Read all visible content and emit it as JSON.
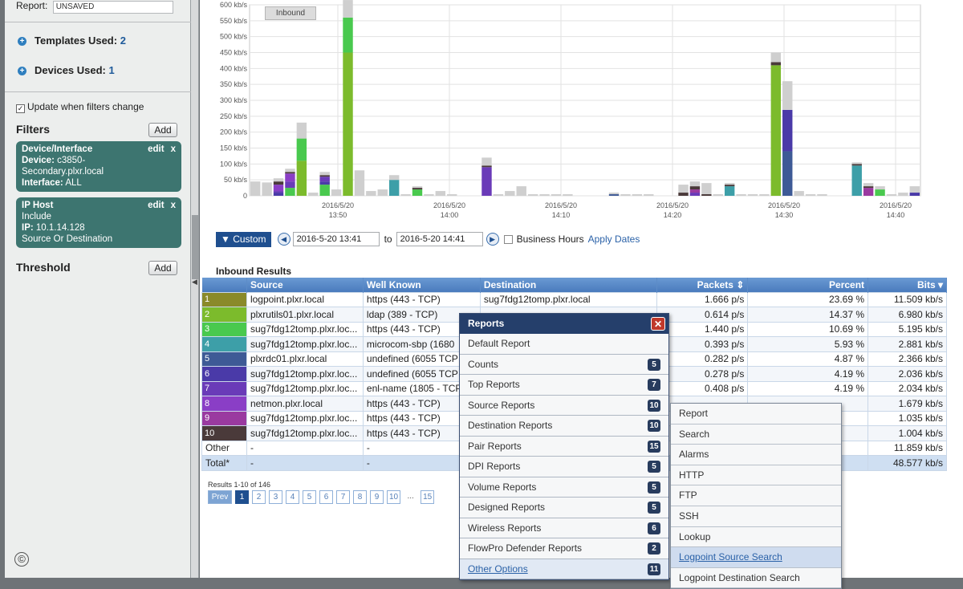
{
  "sidebar": {
    "report_label": "Report:",
    "report_value": "UNSAVED",
    "templates_label": "Templates Used:",
    "templates_count": "2",
    "devices_label": "Devices Used:",
    "devices_count": "1",
    "update_label": "Update when filters change",
    "filters_title": "Filters",
    "add_label": "Add",
    "filter_cards": [
      {
        "title": "Device/Interface",
        "edit": "edit",
        "close": "x",
        "l1_key": "Device:",
        "l1_val": "c3850-",
        "l2": "Secondary.plxr.local",
        "l3_key": "Interface:",
        "l3_val": "ALL"
      },
      {
        "title": "IP Host",
        "edit": "edit",
        "close": "x",
        "l1": "Include",
        "l2_key": "IP:",
        "l2_val": "10.1.14.128",
        "l3": "Source Or Destination"
      }
    ],
    "threshold_title": "Threshold",
    "threshold_add": "Add",
    "copyright": "©"
  },
  "chart": {
    "legend_label": "Inbound"
  },
  "chart_data": {
    "type": "bar",
    "stacked": true,
    "ylabel": "",
    "y_unit": "kb/s",
    "ylim": [
      0,
      600
    ],
    "y_ticks": [
      "0",
      "50 kb/s",
      "100 kb/s",
      "150 kb/s",
      "200 kb/s",
      "250 kb/s",
      "300 kb/s",
      "350 kb/s",
      "400 kb/s",
      "450 kb/s",
      "500 kb/s",
      "550 kb/s",
      "600 kb/s"
    ],
    "x_ticks": [
      {
        "d": "2016/5/20",
        "t": "13:50"
      },
      {
        "d": "2016/5/20",
        "t": "14:00"
      },
      {
        "d": "2016/5/20",
        "t": "14:10"
      },
      {
        "d": "2016/5/20",
        "t": "14:20"
      },
      {
        "d": "2016/5/20",
        "t": "14:30"
      },
      {
        "d": "2016/5/20",
        "t": "14:40"
      }
    ],
    "colors": [
      "#8a8a2a",
      "#7cbb2c",
      "#49c94e",
      "#3d9fa8",
      "#3e5a96",
      "#4a3aa8",
      "#6a3bb8",
      "#8a3ec6",
      "#9a3aa0",
      "#4a3a3a",
      "#cfcfcf"
    ],
    "bars": [
      [
        0,
        0,
        0,
        0,
        0,
        0,
        0,
        0,
        0,
        0,
        45
      ],
      [
        0,
        0,
        0,
        0,
        0,
        0,
        0,
        0,
        0,
        0,
        42
      ],
      [
        0,
        0,
        0,
        0,
        0,
        10,
        5,
        20,
        0,
        10,
        10
      ],
      [
        0,
        0,
        25,
        0,
        0,
        0,
        20,
        25,
        0,
        5,
        10
      ],
      [
        0,
        110,
        70,
        0,
        0,
        0,
        0,
        0,
        0,
        0,
        50
      ],
      [
        0,
        0,
        0,
        0,
        0,
        0,
        0,
        0,
        0,
        0,
        10
      ],
      [
        0,
        0,
        35,
        0,
        0,
        10,
        15,
        0,
        0,
        5,
        10
      ],
      [
        0,
        0,
        0,
        0,
        0,
        0,
        0,
        0,
        0,
        0,
        20
      ],
      [
        0,
        450,
        110,
        0,
        0,
        0,
        0,
        0,
        0,
        0,
        55
      ],
      [
        0,
        0,
        0,
        0,
        0,
        0,
        0,
        0,
        0,
        0,
        80
      ],
      [
        0,
        0,
        0,
        0,
        0,
        0,
        0,
        0,
        0,
        0,
        15
      ],
      [
        0,
        0,
        0,
        0,
        0,
        0,
        0,
        0,
        0,
        0,
        20
      ],
      [
        0,
        0,
        0,
        50,
        0,
        0,
        0,
        0,
        0,
        0,
        15
      ],
      [
        0,
        0,
        0,
        0,
        0,
        0,
        0,
        0,
        0,
        0,
        5
      ],
      [
        0,
        0,
        20,
        0,
        0,
        0,
        0,
        0,
        0,
        5,
        5
      ],
      [
        0,
        0,
        0,
        0,
        0,
        0,
        0,
        0,
        0,
        0,
        5
      ],
      [
        0,
        0,
        0,
        0,
        0,
        0,
        0,
        0,
        0,
        0,
        15
      ],
      [
        0,
        0,
        0,
        0,
        0,
        0,
        0,
        0,
        0,
        0,
        5
      ],
      [
        0,
        0,
        0,
        0,
        0,
        0,
        0,
        0,
        0,
        0,
        0
      ],
      [
        0,
        0,
        0,
        0,
        0,
        0,
        0,
        0,
        0,
        0,
        0
      ],
      [
        0,
        0,
        0,
        0,
        0,
        0,
        90,
        0,
        0,
        5,
        25
      ],
      [
        0,
        0,
        0,
        0,
        0,
        0,
        0,
        0,
        0,
        0,
        5
      ],
      [
        0,
        0,
        0,
        0,
        0,
        0,
        0,
        0,
        0,
        0,
        15
      ],
      [
        0,
        0,
        0,
        0,
        0,
        0,
        0,
        0,
        0,
        0,
        30
      ],
      [
        0,
        0,
        0,
        0,
        0,
        0,
        0,
        0,
        0,
        0,
        5
      ],
      [
        0,
        0,
        0,
        0,
        0,
        0,
        0,
        0,
        0,
        0,
        5
      ],
      [
        0,
        0,
        0,
        0,
        0,
        0,
        0,
        0,
        0,
        0,
        5
      ],
      [
        0,
        0,
        0,
        0,
        0,
        0,
        0,
        0,
        0,
        0,
        5
      ],
      [
        0,
        0,
        0,
        0,
        0,
        0,
        0,
        0,
        0,
        0,
        0
      ],
      [
        0,
        0,
        0,
        0,
        0,
        0,
        0,
        0,
        0,
        0,
        0
      ],
      [
        0,
        0,
        0,
        0,
        0,
        0,
        0,
        0,
        0,
        0,
        0
      ],
      [
        0,
        0,
        0,
        0,
        5,
        0,
        0,
        0,
        0,
        0,
        5
      ],
      [
        0,
        0,
        0,
        0,
        0,
        0,
        0,
        0,
        0,
        0,
        5
      ],
      [
        0,
        0,
        0,
        0,
        0,
        0,
        0,
        0,
        0,
        0,
        5
      ],
      [
        0,
        0,
        0,
        0,
        0,
        0,
        0,
        0,
        0,
        0,
        5
      ],
      [
        0,
        0,
        0,
        0,
        0,
        0,
        0,
        0,
        0,
        0,
        0
      ],
      [
        0,
        0,
        0,
        0,
        0,
        0,
        0,
        0,
        0,
        0,
        0
      ],
      [
        0,
        0,
        0,
        0,
        0,
        0,
        0,
        0,
        0,
        10,
        25
      ],
      [
        0,
        0,
        0,
        0,
        0,
        0,
        10,
        0,
        10,
        10,
        15
      ],
      [
        0,
        0,
        0,
        0,
        0,
        0,
        0,
        0,
        0,
        5,
        35
      ],
      [
        0,
        0,
        0,
        0,
        0,
        0,
        0,
        0,
        0,
        0,
        5
      ],
      [
        0,
        0,
        0,
        30,
        0,
        0,
        0,
        0,
        0,
        5,
        5
      ],
      [
        0,
        0,
        0,
        0,
        0,
        0,
        0,
        0,
        0,
        0,
        5
      ],
      [
        0,
        0,
        0,
        0,
        0,
        0,
        0,
        0,
        0,
        0,
        5
      ],
      [
        0,
        0,
        0,
        0,
        0,
        0,
        0,
        0,
        0,
        0,
        5
      ],
      [
        0,
        410,
        0,
        0,
        0,
        0,
        0,
        0,
        0,
        10,
        30
      ],
      [
        0,
        0,
        0,
        0,
        140,
        130,
        0,
        0,
        0,
        0,
        90
      ],
      [
        0,
        0,
        0,
        0,
        0,
        0,
        0,
        0,
        0,
        0,
        15
      ],
      [
        0,
        0,
        0,
        0,
        0,
        0,
        0,
        0,
        0,
        0,
        5
      ],
      [
        0,
        0,
        0,
        0,
        0,
        0,
        0,
        0,
        0,
        0,
        5
      ],
      [
        0,
        0,
        0,
        0,
        0,
        0,
        0,
        0,
        0,
        0,
        0
      ],
      [
        0,
        0,
        0,
        0,
        0,
        0,
        0,
        0,
        0,
        0,
        0
      ],
      [
        0,
        0,
        0,
        95,
        0,
        0,
        0,
        0,
        0,
        5,
        5
      ],
      [
        0,
        0,
        0,
        0,
        0,
        0,
        0,
        0,
        25,
        5,
        10
      ],
      [
        0,
        0,
        20,
        0,
        0,
        0,
        0,
        0,
        0,
        0,
        10
      ],
      [
        0,
        0,
        0,
        0,
        0,
        0,
        0,
        0,
        0,
        0,
        5
      ],
      [
        0,
        0,
        0,
        0,
        0,
        0,
        0,
        0,
        0,
        0,
        10
      ],
      [
        0,
        0,
        0,
        0,
        0,
        10,
        0,
        0,
        0,
        0,
        20
      ]
    ]
  },
  "dates": {
    "custom_label": "▼ Custom",
    "start": "2016-5-20 13:41",
    "to_label": "to",
    "end": "2016-5-20 14:41",
    "business_hours": "Business Hours",
    "apply": "Apply Dates"
  },
  "results": {
    "title": "Inbound Results",
    "columns": [
      "Source",
      "Well Known",
      "Destination",
      "Packets ⇕",
      "Percent",
      "Bits ▾"
    ],
    "rows": [
      {
        "n": "1",
        "color": "#8a8a2a",
        "src": "logpoint.plxr.local",
        "wk": "https (443 - TCP)",
        "dst": "sug7fdg12tomp.plxr.local",
        "pk": "1.666 p/s",
        "pct": "23.69 %",
        "bits": "11.509 kb/s"
      },
      {
        "n": "2",
        "color": "#7cbb2c",
        "src": "plxrutils01.plxr.local",
        "wk": "ldap (389 - TCP)",
        "dst": "",
        "pk": "0.614 p/s",
        "pct": "14.37 %",
        "bits": "6.980 kb/s"
      },
      {
        "n": "3",
        "color": "#49c94e",
        "src": "sug7fdg12tomp.plxr.loc...",
        "wk": "https (443 - TCP)",
        "dst": "",
        "pk": "1.440 p/s",
        "pct": "10.69 %",
        "bits": "5.195 kb/s"
      },
      {
        "n": "4",
        "color": "#3d9fa8",
        "src": "sug7fdg12tomp.plxr.loc...",
        "wk": "microcom-sbp (1680",
        "dst": "",
        "pk": "0.393 p/s",
        "pct": "5.93 %",
        "bits": "2.881 kb/s"
      },
      {
        "n": "5",
        "color": "#3e5a96",
        "src": "plxrdc01.plxr.local",
        "wk": "undefined (6055 TCP",
        "dst": "",
        "pk": "0.282 p/s",
        "pct": "4.87 %",
        "bits": "2.366 kb/s"
      },
      {
        "n": "6",
        "color": "#4a3aa8",
        "src": "sug7fdg12tomp.plxr.loc...",
        "wk": "undefined (6055 TCP",
        "dst": "",
        "pk": "0.278 p/s",
        "pct": "4.19 %",
        "bits": "2.036 kb/s"
      },
      {
        "n": "7",
        "color": "#6a3bb8",
        "src": "sug7fdg12tomp.plxr.loc...",
        "wk": "enl-name (1805 - TCP",
        "dst": "",
        "pk": "0.408 p/s",
        "pct": "4.19 %",
        "bits": "2.034 kb/s"
      },
      {
        "n": "8",
        "color": "#8a3ec6",
        "src": "netmon.plxr.local",
        "wk": "https (443 - TCP)",
        "dst": "",
        "pk": "",
        "pct": "",
        "bits": "1.679 kb/s"
      },
      {
        "n": "9",
        "color": "#9a3aa0",
        "src": "sug7fdg12tomp.plxr.loc...",
        "wk": "https (443 - TCP)",
        "dst": "",
        "pk": "",
        "pct": "",
        "bits": "1.035 kb/s"
      },
      {
        "n": "10",
        "color": "#4a3a3a",
        "src": "sug7fdg12tomp.plxr.loc...",
        "wk": "https (443 - TCP)",
        "dst": "",
        "pk": "",
        "pct": "",
        "bits": "1.004 kb/s"
      }
    ],
    "other": {
      "label": "Other",
      "src": "-",
      "wk": "-",
      "bits": "11.859 kb/s"
    },
    "total": {
      "label": "Total*",
      "src": "-",
      "wk": "-",
      "bits": "48.577 kb/s"
    },
    "pager_text": "Results 1-10 of 146",
    "prev": "Prev",
    "pages": [
      "1",
      "2",
      "3",
      "4",
      "5",
      "6",
      "7",
      "8",
      "9",
      "10",
      "...",
      "15"
    ]
  },
  "reports_menu": {
    "title": "Reports",
    "close": "✕",
    "items": [
      {
        "label": "Default Report",
        "badge": ""
      },
      {
        "label": "Counts",
        "badge": "5"
      },
      {
        "label": "Top Reports",
        "badge": "7"
      },
      {
        "label": "Source Reports",
        "badge": "10"
      },
      {
        "label": "Destination Reports",
        "badge": "10"
      },
      {
        "label": "Pair Reports",
        "badge": "15"
      },
      {
        "label": "DPI Reports",
        "badge": "5"
      },
      {
        "label": "Volume Reports",
        "badge": "5"
      },
      {
        "label": "Designed Reports",
        "badge": "5"
      },
      {
        "label": "Wireless Reports",
        "badge": "6"
      },
      {
        "label": "FlowPro Defender Reports",
        "badge": "2"
      },
      {
        "label": "Other Options",
        "badge": "11"
      }
    ]
  },
  "sub_menu": {
    "items": [
      "Report",
      "Search",
      "Alarms",
      "HTTP",
      "FTP",
      "SSH",
      "Lookup",
      "Logpoint Source Search",
      "Logpoint Destination Search"
    ]
  }
}
